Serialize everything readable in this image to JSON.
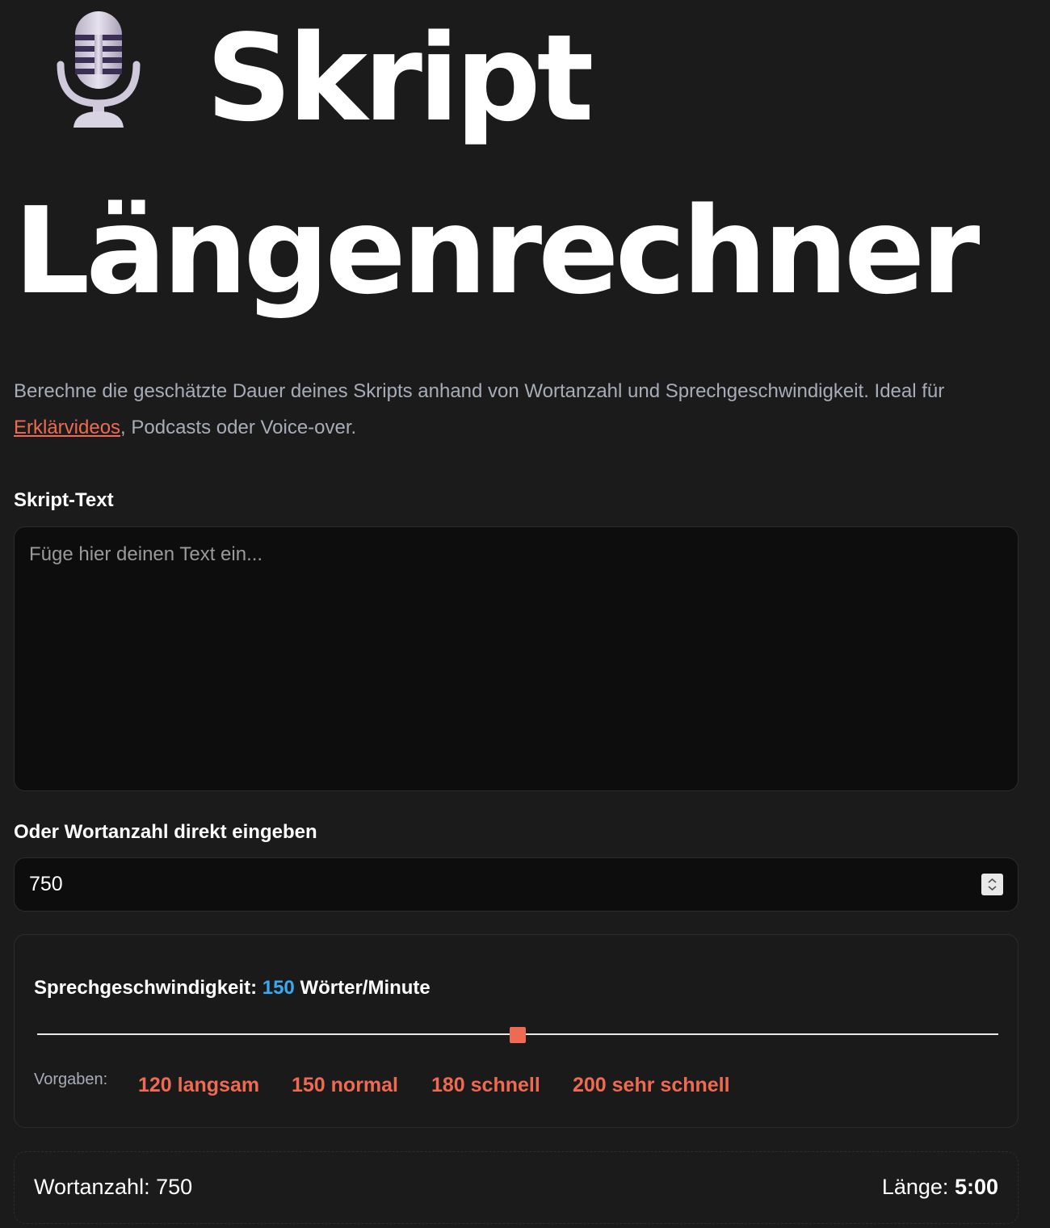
{
  "header": {
    "title_line1": "Skript",
    "title_line2": "Längenrechner",
    "icon": "microphone-icon"
  },
  "intro": {
    "text_before": "Berechne die geschätzte Dauer deines Skripts anhand von Wortanzahl und Sprechgeschwindigkeit. Ideal für ",
    "link_text": "Erklärvideos",
    "text_after": ", Podcasts oder Voice-over."
  },
  "script_input": {
    "label": "Skript-Text",
    "placeholder": "Füge hier deinen Text ein...",
    "value": ""
  },
  "word_count_input": {
    "label": "Oder Wortanzahl direkt eingeben",
    "value": "750"
  },
  "speed": {
    "label": "Sprechgeschwindigkeit:",
    "value": "150",
    "unit": "Wörter/Minute",
    "slider_fraction": 0.5,
    "presets_label": "Vorgaben:",
    "presets": [
      {
        "label": "120 langsam"
      },
      {
        "label": "150 normal"
      },
      {
        "label": "180 schnell"
      },
      {
        "label": "200 sehr schnell"
      }
    ]
  },
  "result": {
    "words_label": "Wortanzahl:",
    "words_value": "750",
    "length_label": "Länge:",
    "length_value": "5:00"
  },
  "colors": {
    "background": "#1b1b1b",
    "accent": "#ee6a52",
    "speed_value": "#3aa9f0",
    "muted_text": "#a7adb8"
  }
}
